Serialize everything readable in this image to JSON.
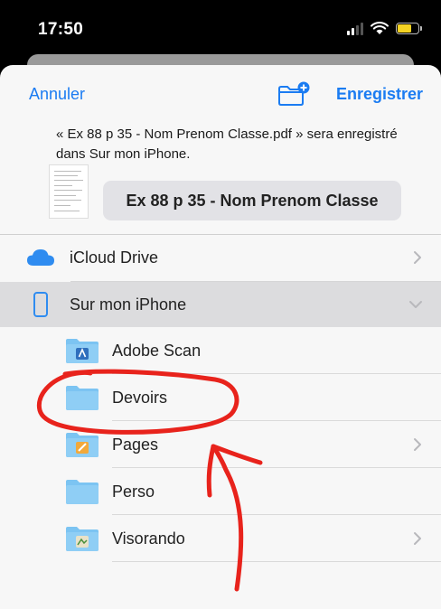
{
  "status_bar": {
    "time": "17:50"
  },
  "nav": {
    "cancel_label": "Annuler",
    "save_label": "Enregistrer"
  },
  "save_message": "« Ex 88 p 35 - Nom Prenom Classe.pdf » sera enregistré dans Sur mon iPhone.",
  "filename": "Ex 88 p 35 - Nom Prenom Classe",
  "locations": [
    {
      "label": "iCloud Drive",
      "icon": "cloud-icon",
      "chevron": "chevron-right",
      "selected": false
    },
    {
      "label": "Sur mon iPhone",
      "icon": "iphone-icon",
      "chevron": "chevron-down",
      "selected": true
    }
  ],
  "folders": [
    {
      "label": "Adobe Scan",
      "icon": "adobe-scan-folder-icon",
      "has_chevron": false
    },
    {
      "label": "Devoirs",
      "icon": "folder-icon",
      "has_chevron": false
    },
    {
      "label": "Pages",
      "icon": "pages-folder-icon",
      "has_chevron": true
    },
    {
      "label": "Perso",
      "icon": "folder-icon",
      "has_chevron": false
    },
    {
      "label": "Visorando",
      "icon": "visorando-folder-icon",
      "has_chevron": true
    }
  ],
  "colors": {
    "accent": "#1b7cf2",
    "folder": "#7cc4f2",
    "annotation": "#e8231c",
    "battery": "#f5d323"
  }
}
